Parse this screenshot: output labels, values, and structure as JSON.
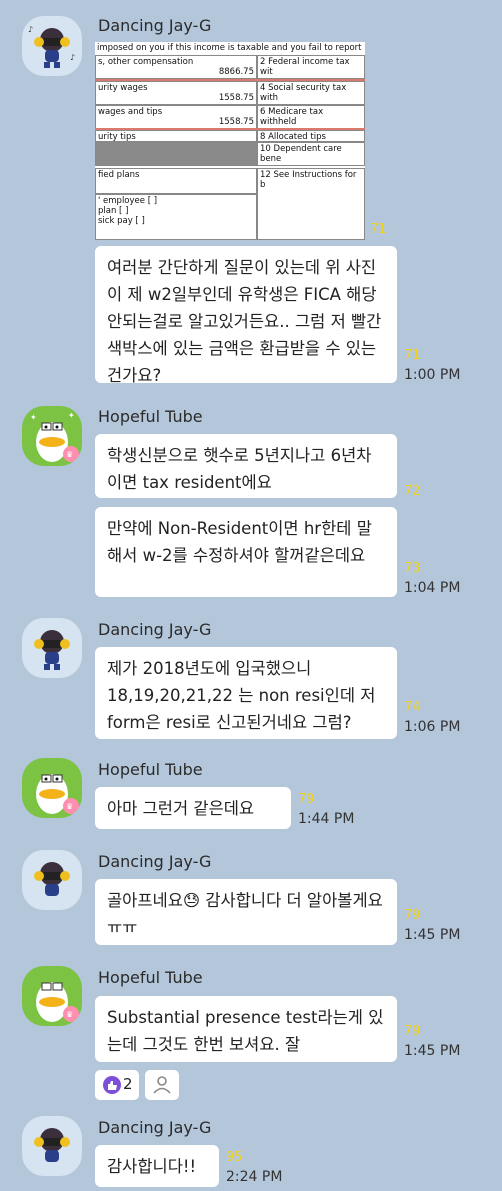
{
  "messages": {
    "m1": {
      "name": "Dancing Jay-G",
      "photo_unread": "71"
    },
    "photo": {
      "header": "imposed on you if this income is taxable and you fail to report",
      "c1_label": "s, other compensation",
      "c1_value": "8866.75",
      "c2_label": "2 Federal income tax wit",
      "c3_label": "urity wages",
      "c3_value": "1558.75",
      "c4_label": "4 Social security tax with",
      "c5_label": "wages and tips",
      "c5_value": "1558.75",
      "c6_label": "6 Medicare tax withheld",
      "c7_label": "urity tips",
      "c8_label": "8 Allocated tips",
      "c10_label": "10 Dependent care bene",
      "c11_label": "fied plans",
      "c12_label": "12 See Instructions for b",
      "c13_line1": "' employee [ ]",
      "c13_line2": "plan [ ]",
      "c13_line3": "sick pay [ ]"
    },
    "m1_text": {
      "text": "여러분 간단하게 질문이 있는데 위 사진이 제 w2일부인데 유학생은 FICA 해당 안되는걸로 알고있거든요.. 그럼 저 빨간색박스에 있는 금액은 환급받을 수 있는건가요?",
      "unread": "71",
      "time": "1:00 PM"
    },
    "m2": {
      "name": "Hopeful Tube",
      "text1": "학생신분으로 햇수로 5년지나고 6년차이면 tax resident에요",
      "unread1": "72",
      "text2": "만약에 Non-Resident이면 hr한테 말해서 w-2를 수정하셔야 할꺼같은데요",
      "unread2": "73",
      "time": "1:04 PM"
    },
    "m3": {
      "name": "Dancing Jay-G",
      "text": "제가 2018년도에 입국했으니 18,19,20,21,22 는 non resi인데 저 form은 resi로 신고된거네요 그럼?",
      "unread": "74",
      "time": "1:06 PM"
    },
    "m4": {
      "name": "Hopeful Tube",
      "text": "아마 그런거 같은데요",
      "unread": "79",
      "time": "1:44 PM"
    },
    "m5": {
      "name": "Dancing Jay-G",
      "text": "골아프네요😓 감사합니다 더 알아볼게요 ㅠㅠ",
      "unread": "79",
      "time": "1:45 PM"
    },
    "m6": {
      "name": "Hopeful Tube",
      "text": "Substantial presence test라는게 있는데 그것도 한번 보셔요. 잘",
      "unread": "79",
      "time": "1:45 PM",
      "reaction_count": "2"
    },
    "m7": {
      "name": "Dancing Jay-G",
      "text": "감사합니다!!",
      "unread": "95",
      "time": "2:24 PM"
    }
  },
  "colors": {
    "background": "#b3c6da",
    "unread": "#f2d320",
    "reaction": "#7b4fd8",
    "red_box": "#d97a6a"
  },
  "icons": {
    "jay": "dancing-character-avatar",
    "tube": "duck-character-avatar",
    "reaction": "thumbs-up-icon",
    "person": "person-icon"
  }
}
